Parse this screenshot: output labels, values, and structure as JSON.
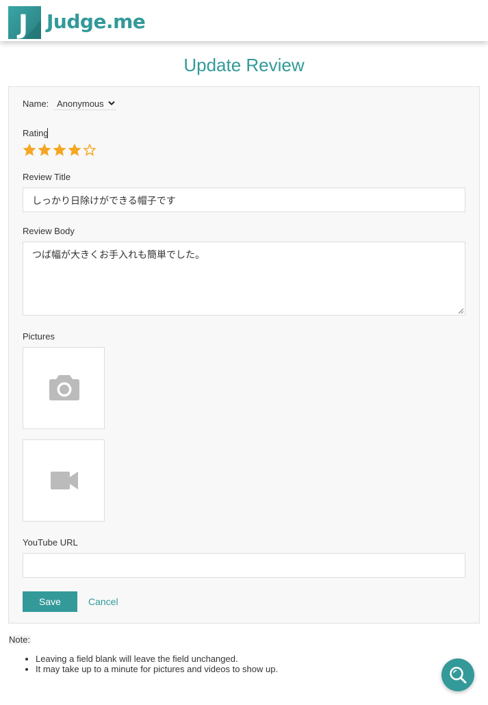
{
  "brand": {
    "logo_letter": "J",
    "name": "Judge.me",
    "accent_color": "#339999",
    "logo_icon": "judgeme-logo-icon"
  },
  "page": {
    "title": "Update Review"
  },
  "form": {
    "name_label": "Name:",
    "name_value": "Anonymous",
    "rating_label": "Rating",
    "rating": {
      "value": 4,
      "max": 5,
      "star_color": "#f5a623"
    },
    "review_title_label": "Review Title",
    "review_title_value": "しっかり日除けができる帽子です",
    "review_body_label": "Review Body",
    "review_body_value": "つば幅が大きくお手入れも簡単でした。",
    "pictures_label": "Pictures",
    "picture_upload_icon": "camera-icon",
    "video_upload_icon": "video-camera-icon",
    "youtube_label": "YouTube URL",
    "youtube_value": "",
    "save_label": "Save",
    "cancel_label": "Cancel"
  },
  "notes": {
    "label": "Note:",
    "items": [
      "Leaving a field blank will leave the field unchanged.",
      "It may take up to a minute for pictures and videos to show up."
    ]
  },
  "floating_button": {
    "icon": "search-icon"
  }
}
